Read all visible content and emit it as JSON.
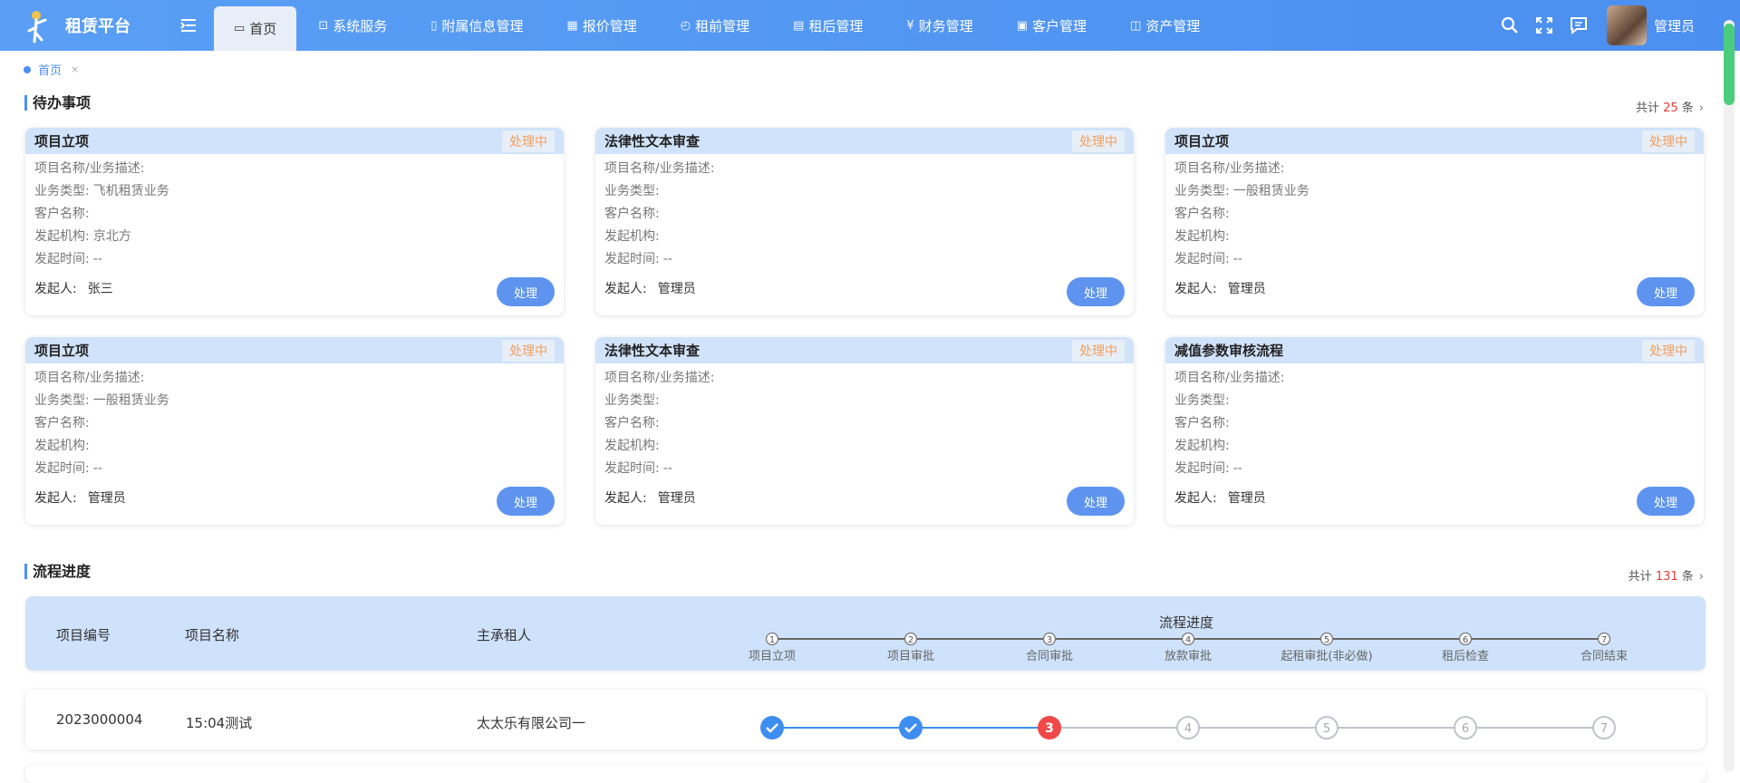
{
  "app": {
    "name": "租赁平台",
    "user_name": "管理员"
  },
  "nav": [
    {
      "label": "首页",
      "icon": "home-icon",
      "active": true
    },
    {
      "label": "系统服务",
      "icon": "monitor-icon"
    },
    {
      "label": "附属信息管理",
      "icon": "document-icon"
    },
    {
      "label": "报价管理",
      "icon": "chart-icon"
    },
    {
      "label": "租前管理",
      "icon": "clock-icon"
    },
    {
      "label": "租后管理",
      "icon": "file-icon"
    },
    {
      "label": "财务管理",
      "icon": "yen-icon"
    },
    {
      "label": "客户管理",
      "icon": "customer-icon"
    },
    {
      "label": "资产管理",
      "icon": "asset-icon"
    }
  ],
  "breadcrumb": {
    "label": "首页",
    "close": "×"
  },
  "todo": {
    "title": "待办事项",
    "count_prefix": "共计",
    "count": "25",
    "count_suffix": "条",
    "field_labels": {
      "desc": "项目名称/业务描述:",
      "type": "业务类型:",
      "customer": "客户名称:",
      "org": "发起机构:",
      "time": "发起时间:",
      "initiator": "发起人:"
    },
    "status_label": "处理中",
    "button_label": "处理",
    "cards": [
      {
        "title": "项目立项",
        "desc": "",
        "type": "飞机租赁业务",
        "customer": "",
        "org": "京北方",
        "time": "--",
        "initiator": "张三"
      },
      {
        "title": "法律性文本审查",
        "desc": "",
        "type": "",
        "customer": "",
        "org": "",
        "time": "--",
        "initiator": "管理员"
      },
      {
        "title": "项目立项",
        "desc": "",
        "type": "一般租赁业务",
        "customer": "",
        "org": "",
        "time": "--",
        "initiator": "管理员"
      },
      {
        "title": "项目立项",
        "desc": "",
        "type": "一般租赁业务",
        "customer": "",
        "org": "",
        "time": "--",
        "initiator": "管理员"
      },
      {
        "title": "法律性文本审查",
        "desc": "",
        "type": "",
        "customer": "",
        "org": "",
        "time": "--",
        "initiator": "管理员"
      },
      {
        "title": "减值参数审核流程",
        "desc": "",
        "type": "",
        "customer": "",
        "org": "",
        "time": "--",
        "initiator": "管理员"
      }
    ]
  },
  "process": {
    "title": "流程进度",
    "count_prefix": "共计",
    "count": "131",
    "count_suffix": "条",
    "columns": {
      "code": "项目编号",
      "name": "项目名称",
      "lessee": "主承租人",
      "progress": "流程进度"
    },
    "steps": [
      "项目立项",
      "项目审批",
      "合同审批",
      "放款审批",
      "起租审批(非必做)",
      "租后检查",
      "合同结束"
    ],
    "rows": [
      {
        "code": "2023000004",
        "name": "15:04测试",
        "lessee": "太太乐有限公司一",
        "completed_steps": 2,
        "current_step": 3
      }
    ]
  },
  "colors": {
    "primary": "#4b8ff0",
    "done": "#3d8ef0",
    "current": "#f04848",
    "pending": "#bfc4cc",
    "status": "#f0a060",
    "count": "#e23c3c"
  }
}
